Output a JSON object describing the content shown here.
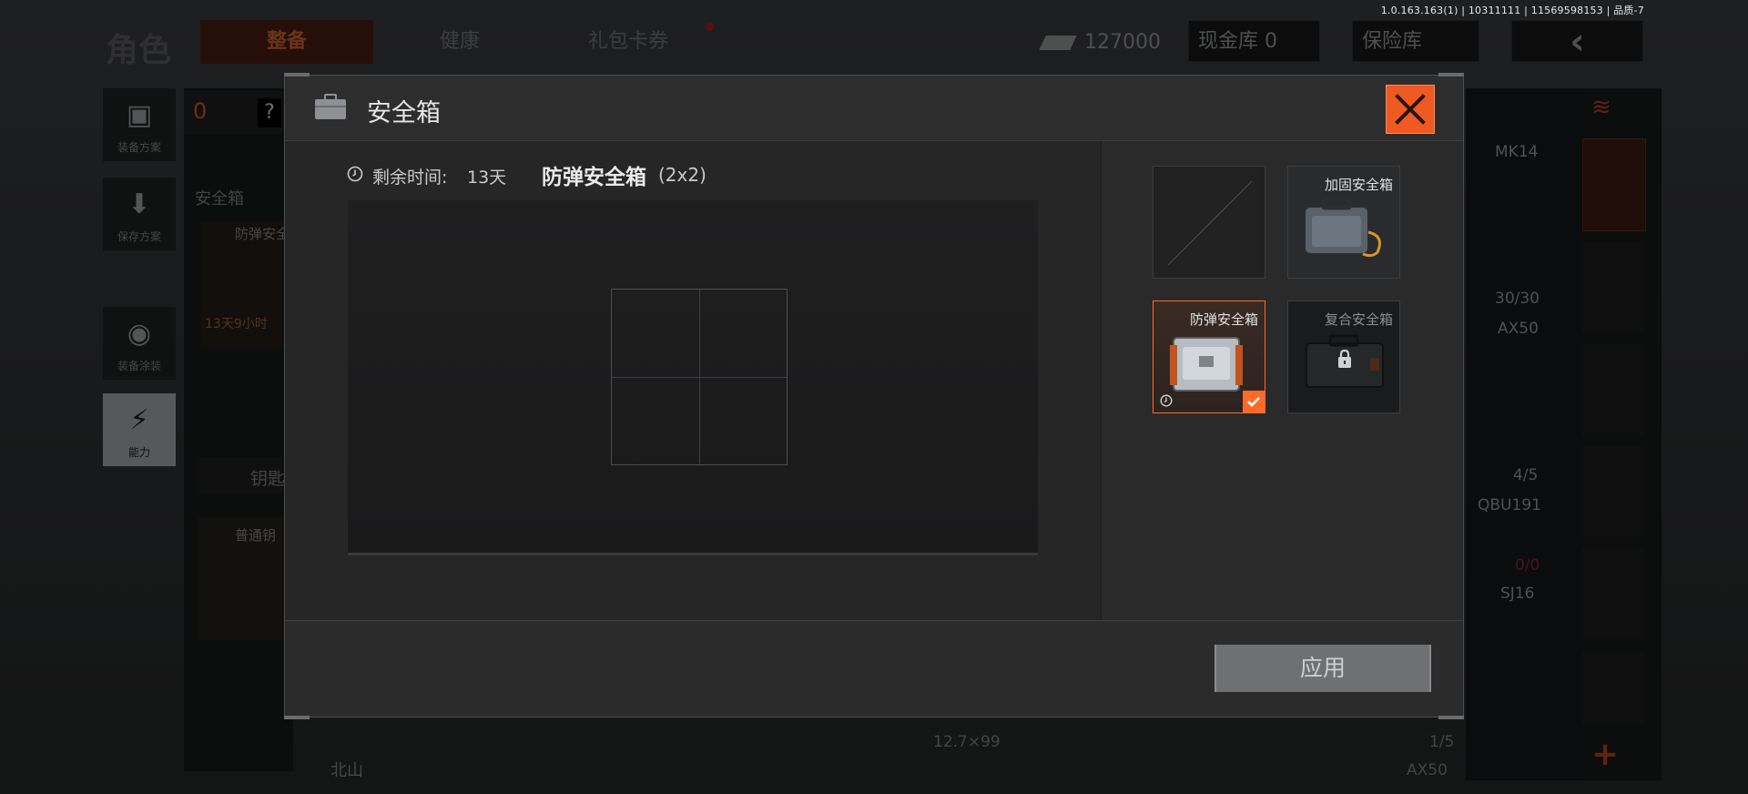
{
  "version": "1.0.163.163(1) | 10311111 | 11569598153 | 品质-7",
  "background": {
    "title": "角色",
    "tabs": [
      "整备",
      "健康",
      "礼包卡券"
    ],
    "money": "127000",
    "cash_vault": "现金库 0",
    "vault": "保险库",
    "left_buttons": [
      "装备方案",
      "保存方案",
      "装备涂装",
      "能力"
    ],
    "mid": {
      "count": "0",
      "question": "?",
      "safebox_label": "安全箱",
      "item_name": "防弹安全",
      "item_time": "13天9小时",
      "key_label": "钥匙",
      "key_item_name": "普通钥",
      "bottom_text": "北山"
    },
    "right": {
      "weapon1": "MK14",
      "ammo1": "30/30",
      "weapon2": "AX50",
      "ammo2": "4/5",
      "weapon3": "QBU191",
      "ammo3": "0/0",
      "weapon4": "SJ16",
      "ammo_name": "12.7×99",
      "ammo_count": "1/5",
      "ammo_weapon": "AX50"
    }
  },
  "modal": {
    "title": "安全箱",
    "remaining_label": "剩余时间:",
    "remaining_value": "13天",
    "box_name": "防弹安全箱",
    "box_size": "(2x2)",
    "grid": {
      "cols": 2,
      "rows": 2
    },
    "cards": [
      {
        "name": "",
        "state": "empty"
      },
      {
        "name": "加固安全箱",
        "state": "available"
      },
      {
        "name": "防弹安全箱",
        "state": "selected"
      },
      {
        "name": "复合安全箱",
        "state": "locked"
      }
    ],
    "apply_label": "应用"
  },
  "colors": {
    "accent": "#ff6a2a",
    "close_bg": "#ef5a22",
    "modal_bg": "#29292a",
    "apply_bg": "#6f7072"
  }
}
